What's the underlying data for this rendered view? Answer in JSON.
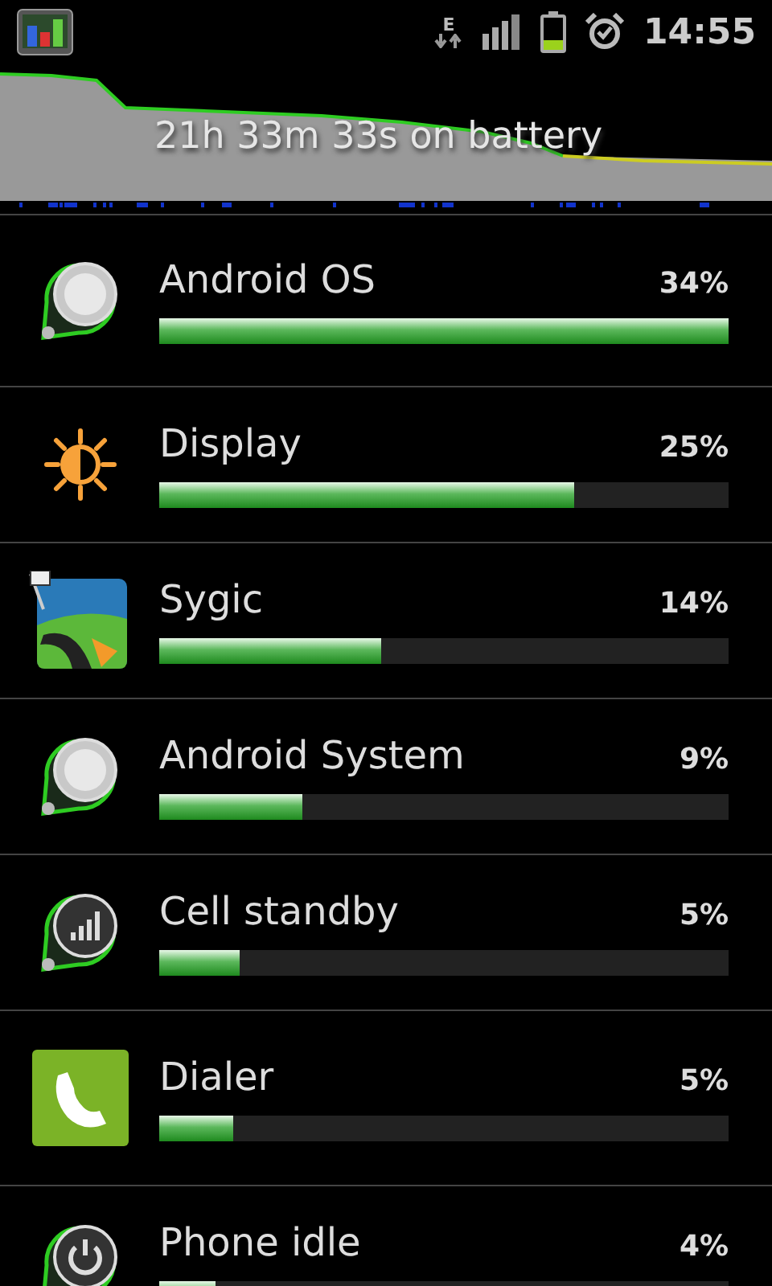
{
  "status_bar": {
    "network_type": "E",
    "time": "14:55"
  },
  "history": {
    "summary": "21h 33m 33s on battery"
  },
  "usage": [
    {
      "name": "Android OS",
      "percent": "34%",
      "level": 1.0,
      "kind": "knob"
    },
    {
      "name": "Display",
      "percent": "25%",
      "level": 0.73,
      "kind": "sun"
    },
    {
      "name": "Sygic",
      "percent": "14%",
      "level": 0.39,
      "kind": "map"
    },
    {
      "name": "Android System",
      "percent": "9%",
      "level": 0.25,
      "kind": "knob"
    },
    {
      "name": "Cell standby",
      "percent": "5%",
      "level": 0.14,
      "kind": "signal"
    },
    {
      "name": "Dialer",
      "percent": "5%",
      "level": 0.13,
      "kind": "phone"
    },
    {
      "name": "Phone idle",
      "percent": "4%",
      "level": 0.1,
      "kind": "power"
    }
  ]
}
